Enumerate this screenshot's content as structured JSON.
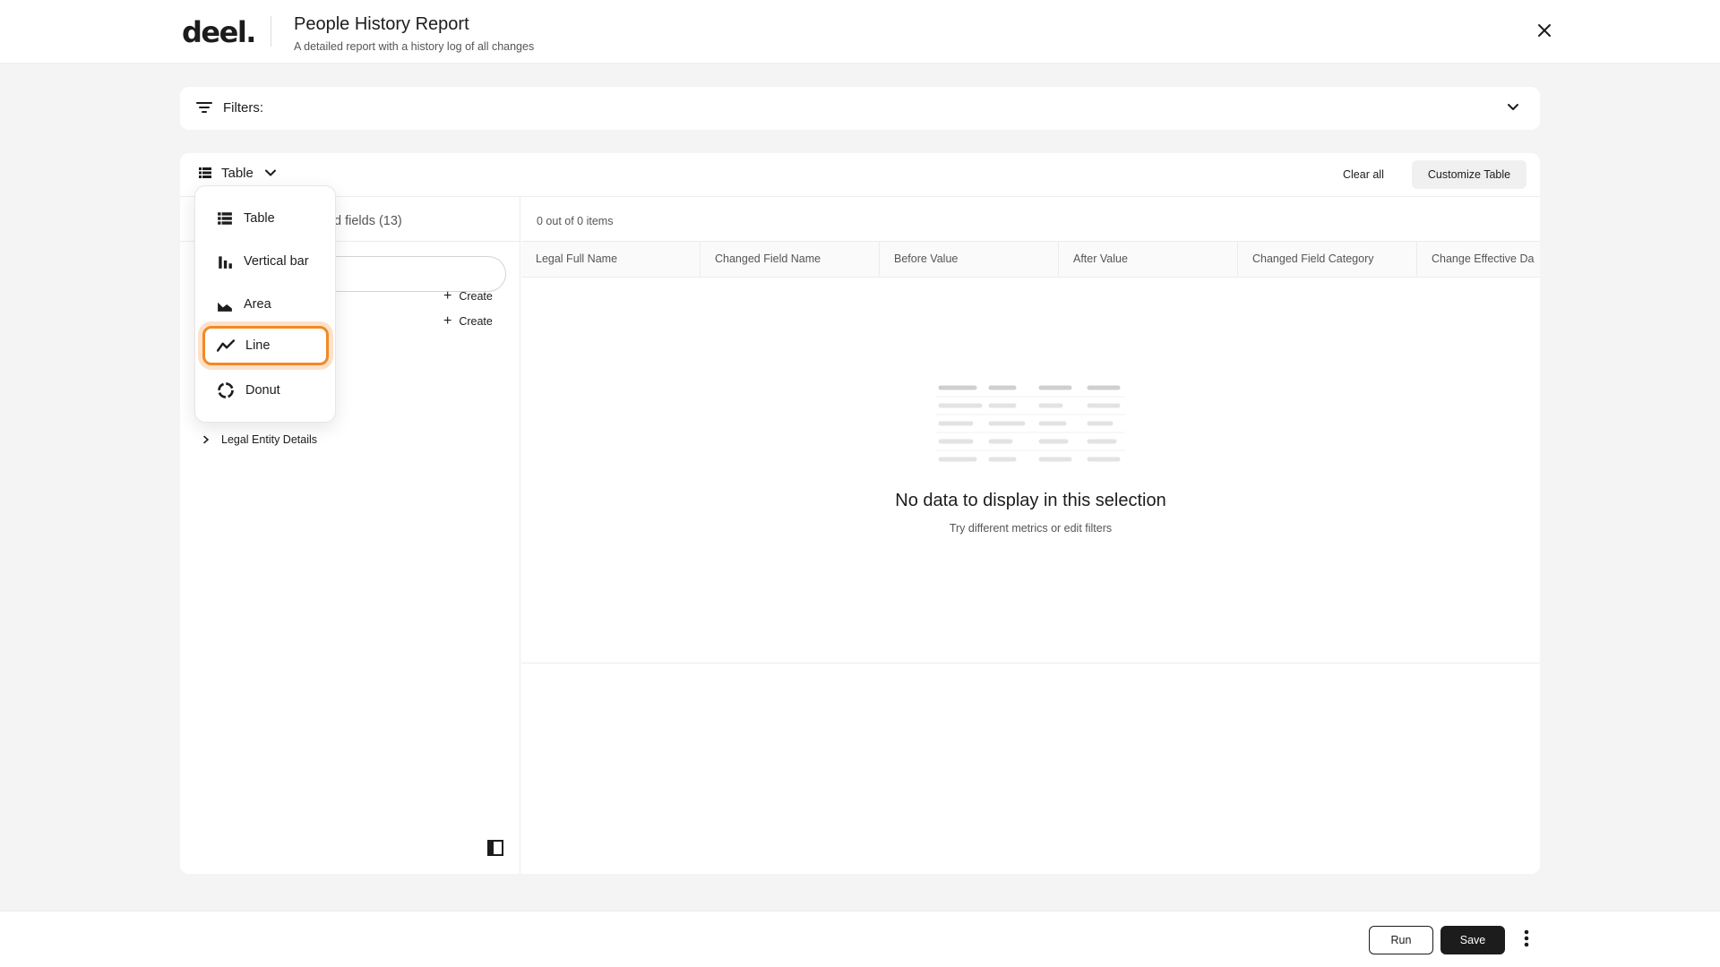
{
  "header": {
    "logo": "deel.",
    "title": "People History Report",
    "subtitle": "A detailed report with a history log of all changes"
  },
  "filters": {
    "label": "Filters:"
  },
  "toolbar": {
    "view_label": "Table",
    "clear_all": "Clear all",
    "customize": "Customize Table"
  },
  "left_panel": {
    "tab_label": "d fields (13)",
    "create_label": "Create",
    "legal_entity": "Legal Entity Details"
  },
  "dropdown": {
    "items": [
      {
        "label": "Table",
        "icon": "table-icon"
      },
      {
        "label": "Vertical bar",
        "icon": "bar-chart-icon"
      },
      {
        "label": "Area",
        "icon": "area-chart-icon"
      },
      {
        "label": "Line",
        "icon": "line-chart-icon"
      },
      {
        "label": "Donut",
        "icon": "donut-chart-icon"
      }
    ],
    "selected": "Line"
  },
  "table": {
    "items_count": "0 out of 0 items",
    "columns": [
      "Legal Full Name",
      "Changed Field Name",
      "Before Value",
      "After Value",
      "Changed Field Category",
      "Change Effective Da"
    ],
    "empty_title": "No data to display in this selection",
    "empty_subtitle": "Try different metrics or edit filters"
  },
  "footer": {
    "run": "Run",
    "save": "Save"
  },
  "colors": {
    "accent": "#f08a24",
    "primary": "#1c1c1c"
  }
}
